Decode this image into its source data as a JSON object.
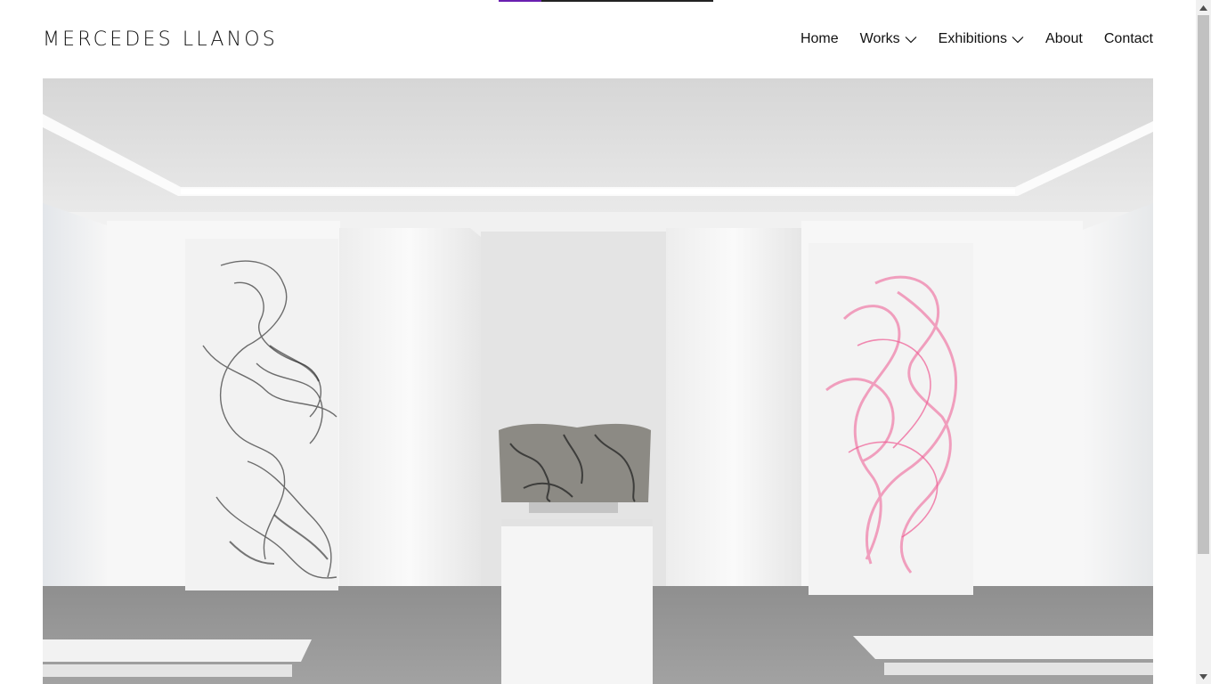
{
  "site": {
    "title": "MERCEDES LLANOS"
  },
  "nav": {
    "items": [
      {
        "label": "Home",
        "has_dropdown": false
      },
      {
        "label": "Works",
        "has_dropdown": true
      },
      {
        "label": "Exhibitions",
        "has_dropdown": true
      },
      {
        "label": "About",
        "has_dropdown": false
      },
      {
        "label": "Contact",
        "has_dropdown": false
      }
    ]
  },
  "hero": {
    "image_alt": "Gallery installation view"
  },
  "loading_progress": 0.2,
  "colors": {
    "accent": "#6a1fb0",
    "text": "#111111",
    "background": "#ffffff"
  },
  "icons": {
    "dropdown": "chevron-down-icon",
    "scroll_up": "scroll-up-arrow-icon",
    "scroll_down": "scroll-down-arrow-icon"
  }
}
